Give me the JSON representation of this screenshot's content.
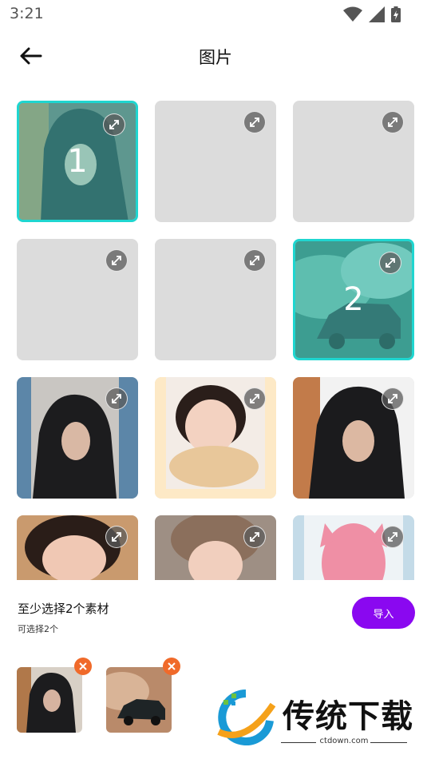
{
  "status": {
    "time": "3:21"
  },
  "header": {
    "title": "图片"
  },
  "grid": {
    "tiles": [
      {
        "kind": "photo-hoodie",
        "selected": true,
        "number": "1"
      },
      {
        "kind": "placeholder",
        "selected": false,
        "number": ""
      },
      {
        "kind": "placeholder",
        "selected": false,
        "number": ""
      },
      {
        "kind": "placeholder",
        "selected": false,
        "number": ""
      },
      {
        "kind": "placeholder",
        "selected": false,
        "number": ""
      },
      {
        "kind": "photo-suv",
        "selected": true,
        "number": "2"
      },
      {
        "kind": "photo-hoodie-window",
        "selected": false,
        "number": ""
      },
      {
        "kind": "photo-girl-frame",
        "selected": false,
        "number": ""
      },
      {
        "kind": "photo-hoodie",
        "selected": false,
        "number": ""
      },
      {
        "kind": "photo-girl-pillow",
        "selected": false,
        "number": ""
      },
      {
        "kind": "photo-girl-hat",
        "selected": false,
        "number": ""
      },
      {
        "kind": "photo-anime-pink",
        "selected": false,
        "number": ""
      }
    ],
    "expand_icon": "expand-arrows-icon"
  },
  "footer": {
    "min_select_text": "至少选择2个素材",
    "can_select_text": "可选择2个",
    "import_label": "导入",
    "selected_thumbs": [
      {
        "kind": "photo-hoodie"
      },
      {
        "kind": "photo-suv"
      }
    ]
  },
  "watermark": {
    "brand": "传统下载",
    "url": "ctdown.com"
  },
  "colors": {
    "accent_purple": "#8a08f0",
    "selection_cyan": "#1fd6d0",
    "remove_orange": "#f06a2a",
    "placeholder_gray": "#dcdcdc"
  }
}
